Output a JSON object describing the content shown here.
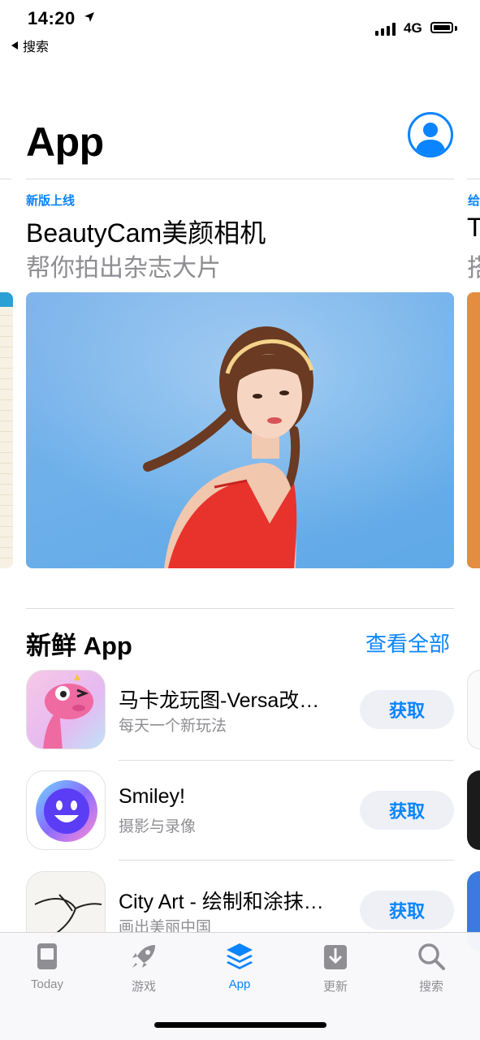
{
  "status_bar": {
    "time": "14:20",
    "back_label": "搜索",
    "network": "4G"
  },
  "header": {
    "title": "App"
  },
  "featured": {
    "tag": "新版上线",
    "title": "BeautyCam美颜相机",
    "subtitle": "帮你拍出杂志大片",
    "next_tag": "给",
    "next_title": "T",
    "next_subtitle": "搭"
  },
  "section": {
    "title": "新鲜 App",
    "see_all": "查看全部",
    "apps": [
      {
        "name": "马卡龙玩图-Versa改图神器",
        "category": "每天一个新玩法",
        "button": "获取"
      },
      {
        "name": "Smiley!",
        "category": "摄影与录像",
        "button": "获取"
      },
      {
        "name": "City Art - 绘制和涂抹彩色城市",
        "category": "画出美丽中国",
        "button": "获取"
      }
    ]
  },
  "tabbar": {
    "active": "App",
    "tabs": [
      {
        "label": "Today",
        "icon": "today-icon"
      },
      {
        "label": "游戏",
        "icon": "rocket-icon"
      },
      {
        "label": "App",
        "icon": "app-stack-icon"
      },
      {
        "label": "更新",
        "icon": "download-icon"
      },
      {
        "label": "搜索",
        "icon": "search-icon"
      }
    ]
  },
  "colors": {
    "accent": "#0a84ff",
    "secondary_text": "#8e8e93",
    "button_bg": "#eef0f6"
  }
}
